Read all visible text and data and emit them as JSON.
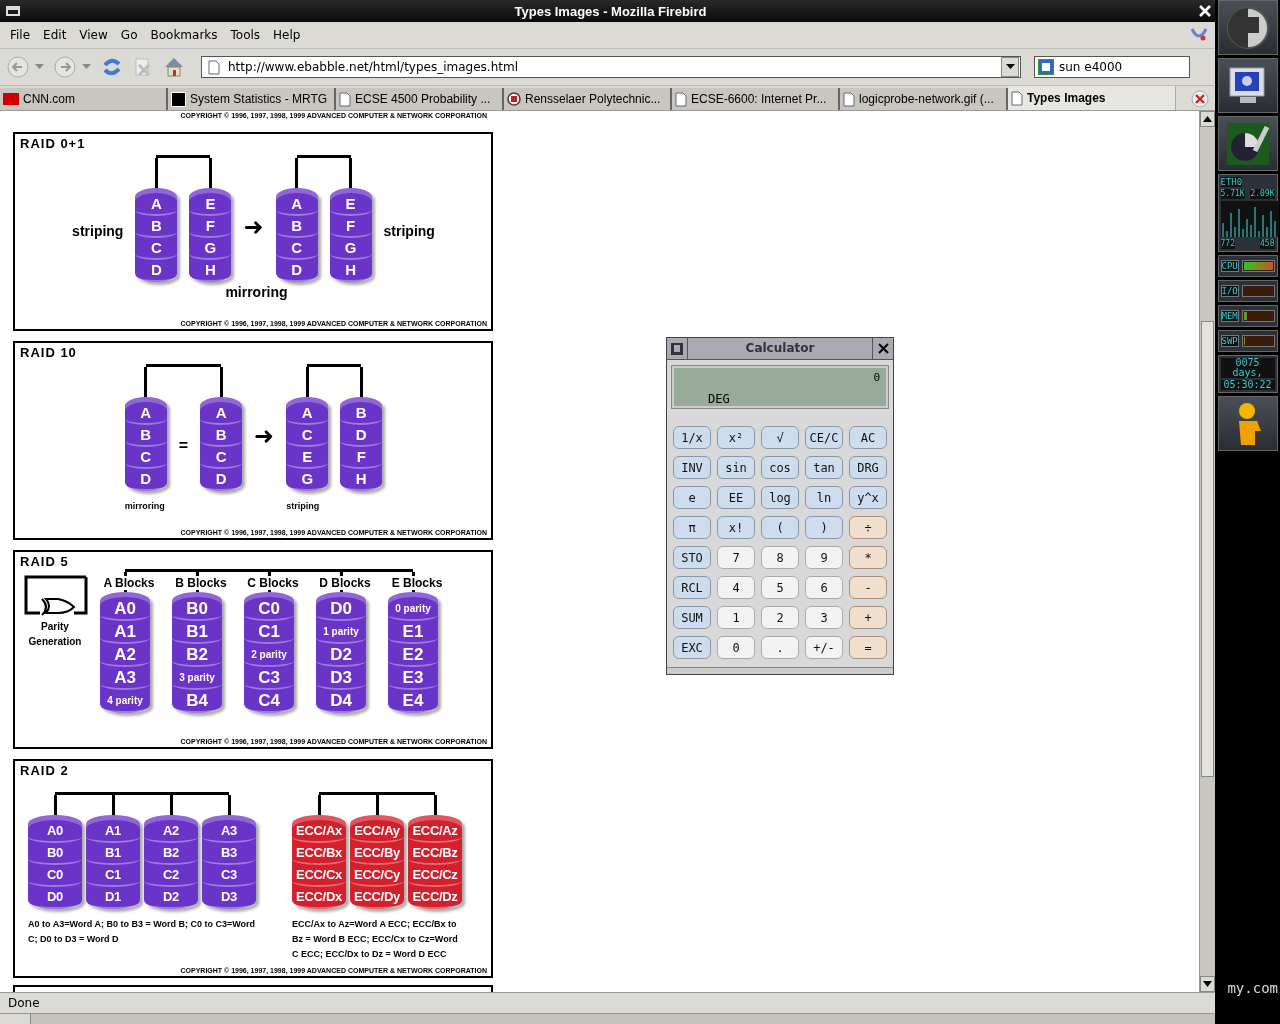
{
  "window": {
    "title": "Types Images - Mozilla Firebird"
  },
  "menu": [
    "File",
    "Edit",
    "View",
    "Go",
    "Bookmarks",
    "Tools",
    "Help"
  ],
  "toolbar": {
    "address": "http://www.ebabble.net/html/types_images.html",
    "search": "sun e4000"
  },
  "tabs": [
    {
      "label": "CNN.com",
      "selected": false,
      "kind": "cnn"
    },
    {
      "label": "System Statistics - MRTG",
      "selected": false,
      "kind": "p"
    },
    {
      "label": "ECSE 4500 Probability ...",
      "selected": false,
      "kind": "page"
    },
    {
      "label": "Rensselaer Polytechnic...",
      "selected": false,
      "kind": "seal"
    },
    {
      "label": "ECSE-6600: Internet Pr...",
      "selected": false,
      "kind": "page"
    },
    {
      "label": "logicprobe-network.gif (...",
      "selected": false,
      "kind": "page"
    },
    {
      "label": "Types Images",
      "selected": true,
      "kind": "page"
    }
  ],
  "page": {
    "top_copyright": "COPYRIGHT © 1996, 1997, 1998, 1999 ADVANCED COMPUTER & NETWORK CORPORATION",
    "diagrams": [
      {
        "kind": "mirror",
        "title": "RAID 0+1",
        "left_label": "striping",
        "right_label": "striping",
        "joiner": "➜",
        "caption": "mirroring",
        "groups": [
          {
            "disks": [
              {
                "color": "#6a34c8",
                "blocks": [
                  "A",
                  "B",
                  "C",
                  "D"
                ]
              },
              {
                "color": "#6a34c8",
                "blocks": [
                  "E",
                  "F",
                  "G",
                  "H"
                ]
              }
            ]
          },
          {
            "disks": [
              {
                "color": "#6a34c8",
                "blocks": [
                  "A",
                  "B",
                  "C",
                  "D"
                ]
              },
              {
                "color": "#6a34c8",
                "blocks": [
                  "E",
                  "F",
                  "G",
                  "H"
                ]
              }
            ]
          }
        ],
        "copyright": "COPYRIGHT © 1996, 1997, 1998, 1999 ADVANCED COMPUTER & NETWORK CORPORATION"
      },
      {
        "kind": "mirror",
        "title": "RAID 10",
        "joiner": "➜",
        "groups": [
          {
            "separator": "=",
            "caption": "mirroring",
            "disks": [
              {
                "color": "#6a34c8",
                "blocks": [
                  "A",
                  "B",
                  "C",
                  "D"
                ]
              },
              {
                "color": "#6a34c8",
                "blocks": [
                  "A",
                  "B",
                  "C",
                  "D"
                ]
              }
            ]
          },
          {
            "caption": "striping",
            "disks": [
              {
                "color": "#6a34c8",
                "blocks": [
                  "A",
                  "C",
                  "E",
                  "G"
                ]
              },
              {
                "color": "#6a34c8",
                "blocks": [
                  "B",
                  "D",
                  "F",
                  "H"
                ]
              }
            ]
          }
        ],
        "copyright": "COPYRIGHT © 1996, 1997, 1998, 1999 ADVANCED COMPUTER & NETWORK CORPORATION"
      },
      {
        "kind": "parity",
        "title": "RAID 5",
        "gate_label": "Parity Generation",
        "groups": [
          {
            "disks": [
              {
                "header": "A Blocks",
                "color": "#6a34c8",
                "blocks": [
                  "A0",
                  "A1",
                  "A2",
                  "A3",
                  "4 parity"
                ]
              },
              {
                "header": "B Blocks",
                "color": "#6a34c8",
                "blocks": [
                  "B0",
                  "B1",
                  "B2",
                  "3 parity",
                  "B4"
                ]
              },
              {
                "header": "C Blocks",
                "color": "#6a34c8",
                "blocks": [
                  "C0",
                  "C1",
                  "2 parity",
                  "C3",
                  "C4"
                ]
              },
              {
                "header": "D Blocks",
                "color": "#6a34c8",
                "blocks": [
                  "D0",
                  "1 parity",
                  "D2",
                  "D3",
                  "D4"
                ]
              },
              {
                "header": "E Blocks",
                "color": "#6a34c8",
                "blocks": [
                  "0 parity",
                  "E1",
                  "E2",
                  "E3",
                  "E4"
                ]
              }
            ]
          }
        ],
        "copyright": "COPYRIGHT © 1996, 1997, 1998, 1999 ADVANCED COMPUTER & NETWORK CORPORATION"
      },
      {
        "kind": "ecc",
        "title": "RAID 2",
        "groups": [
          {
            "caption": "A0 to A3=Word A; B0 to B3 = Word B; C0 to C3=Word C; D0 to D3 = Word D",
            "disks": [
              {
                "color": "#6a34c8",
                "blocks": [
                  "A0",
                  "B0",
                  "C0",
                  "D0"
                ]
              },
              {
                "color": "#6a34c8",
                "blocks": [
                  "A1",
                  "B1",
                  "C1",
                  "D1"
                ]
              },
              {
                "color": "#6a34c8",
                "blocks": [
                  "A2",
                  "B2",
                  "C2",
                  "D2"
                ]
              },
              {
                "color": "#6a34c8",
                "blocks": [
                  "A3",
                  "B3",
                  "C3",
                  "D3"
                ]
              }
            ]
          },
          {
            "caption": "ECC/Ax to Az=Word A ECC; ECC/Bx to Bz = Word B ECC; ECC/Cx to Cz=Word C ECC; ECC/Dx to Dz = Word D ECC",
            "disks": [
              {
                "color": "#d4202c",
                "blocks": [
                  "ECC/Ax",
                  "ECC/Bx",
                  "ECC/Cx",
                  "ECC/Dx"
                ]
              },
              {
                "color": "#d4202c",
                "blocks": [
                  "ECC/Ay",
                  "ECC/By",
                  "ECC/Cy",
                  "ECC/Dy"
                ]
              },
              {
                "color": "#d4202c",
                "blocks": [
                  "ECC/Az",
                  "ECC/Bz",
                  "ECC/Cz",
                  "ECC/Dz"
                ]
              }
            ]
          }
        ],
        "copyright": "COPYRIGHT © 1996, 1997, 1998, 1999 ADVANCED COMPUTER & NETWORK CORPORATION"
      }
    ]
  },
  "calculator": {
    "title": "Calculator",
    "display": "0",
    "mode": "DEG",
    "keys": [
      {
        "label": "1/x",
        "kind": "fn"
      },
      {
        "label": "x²",
        "kind": "fn"
      },
      {
        "label": "√",
        "kind": "fn"
      },
      {
        "label": "CE/C",
        "kind": "fn"
      },
      {
        "label": "AC",
        "kind": "fn"
      },
      {
        "label": "INV",
        "kind": "fn"
      },
      {
        "label": "sin",
        "kind": "fn"
      },
      {
        "label": "cos",
        "kind": "fn"
      },
      {
        "label": "tan",
        "kind": "fn"
      },
      {
        "label": "DRG",
        "kind": "fn"
      },
      {
        "label": "e",
        "kind": "fn"
      },
      {
        "label": "EE",
        "kind": "fn"
      },
      {
        "label": "log",
        "kind": "fn"
      },
      {
        "label": "ln",
        "kind": "fn"
      },
      {
        "label": "y^x",
        "kind": "fn"
      },
      {
        "label": "π",
        "kind": "fn"
      },
      {
        "label": "x!",
        "kind": "fn"
      },
      {
        "label": "(",
        "kind": "fn"
      },
      {
        "label": ")",
        "kind": "fn"
      },
      {
        "label": "÷",
        "kind": "op"
      },
      {
        "label": "STO",
        "kind": "fn"
      },
      {
        "label": "7",
        "kind": "num"
      },
      {
        "label": "8",
        "kind": "num"
      },
      {
        "label": "9",
        "kind": "num"
      },
      {
        "label": "*",
        "kind": "op"
      },
      {
        "label": "RCL",
        "kind": "fn"
      },
      {
        "label": "4",
        "kind": "num"
      },
      {
        "label": "5",
        "kind": "num"
      },
      {
        "label": "6",
        "kind": "num"
      },
      {
        "label": "-",
        "kind": "op"
      },
      {
        "label": "SUM",
        "kind": "fn"
      },
      {
        "label": "1",
        "kind": "num"
      },
      {
        "label": "2",
        "kind": "num"
      },
      {
        "label": "3",
        "kind": "num"
      },
      {
        "label": "+",
        "kind": "op"
      },
      {
        "label": "EXC",
        "kind": "fn"
      },
      {
        "label": "0",
        "kind": "num"
      },
      {
        "label": ".",
        "kind": "num"
      },
      {
        "label": "+/-",
        "kind": "num"
      },
      {
        "label": "=",
        "kind": "op"
      }
    ]
  },
  "dock": {
    "eth": {
      "label": "ETH0",
      "rx": "5.71K",
      "tx": "2.09K",
      "rx_total": "772",
      "tx_total": "458"
    },
    "meters": [
      {
        "label": "CPU",
        "level": 1
      },
      {
        "label": "I/O",
        "level": 0.02
      },
      {
        "label": "MEM",
        "level": 0.12
      },
      {
        "label": "SWP",
        "level": 0.03
      }
    ],
    "uptime": [
      "0075 days,",
      "05:30:22"
    ]
  },
  "status_bar": {
    "text": "Done"
  },
  "desktop": {
    "brand": "my.com"
  }
}
